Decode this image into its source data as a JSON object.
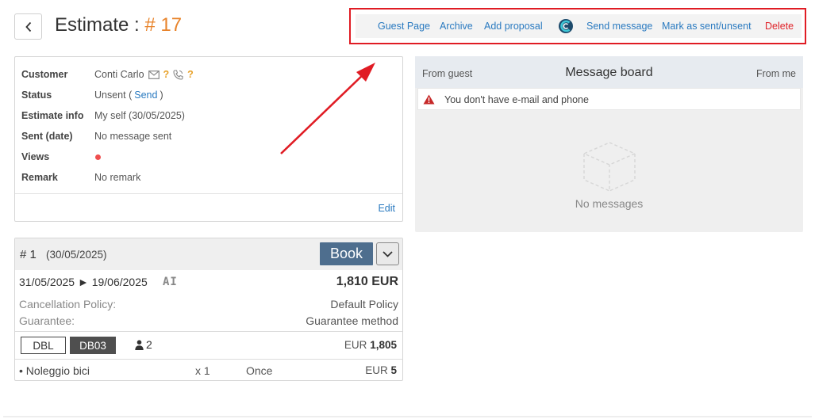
{
  "header": {
    "title": "Estimate :",
    "number": "# 17"
  },
  "toolbar": {
    "guest_page": "Guest Page",
    "archive": "Archive",
    "add_proposal": "Add proposal",
    "send_message": "Send message",
    "mark_sent": "Mark as sent/unsent",
    "delete": "Delete"
  },
  "customer_card": {
    "labels": {
      "customer": "Customer",
      "status": "Status",
      "estimate_info": "Estimate info",
      "sent_date": "Sent (date)",
      "views": "Views",
      "remark": "Remark"
    },
    "customer_name": "Conti Carlo",
    "customer_email_unknown": "?",
    "customer_phone_unknown": "?",
    "status_text": "Unsent (",
    "status_link": "Send",
    "status_close": ")",
    "estimate_info": "My self (30/05/2025)",
    "sent_date": "No message sent",
    "remark": "No remark",
    "edit": "Edit"
  },
  "message_board": {
    "from_guest": "From guest",
    "title": "Message board",
    "from_me": "From me",
    "warning": "You don't have e-mail and phone",
    "empty": "No messages"
  },
  "booking": {
    "number": "# 1",
    "date": "(30/05/2025)",
    "book_label": "Book",
    "dates": "31/05/2025 ► 19/06/2025",
    "ai_label": "AI",
    "total": "1,810 EUR",
    "cancellation_label": "Cancellation Policy:",
    "cancellation_value": "Default Policy",
    "guarantee_label": "Guarantee:",
    "guarantee_value": "Guarantee method",
    "room_type": "DBL",
    "room_code": "DB03",
    "guests": "2",
    "room_currency": "EUR",
    "room_amount": "1,805",
    "extra_name": "• Noleggio bici",
    "extra_qty": "x 1",
    "extra_freq": "Once",
    "extra_currency": "EUR",
    "extra_amount": "5"
  },
  "icons": {
    "back": "chevron-left-icon",
    "email": "envelope-icon",
    "phone": "phone-icon",
    "warning": "warning-triangle-icon",
    "empty": "empty-box-icon",
    "dropdown": "chevron-down-icon",
    "guests": "person-icon",
    "logo": "messaging-logo-icon"
  },
  "colors": {
    "accent_orange": "#e8832a",
    "link_blue": "#2a7ac0",
    "danger_red": "#e0242a",
    "book_button": "#4e6e8e",
    "annotation_red": "#e01c24"
  }
}
